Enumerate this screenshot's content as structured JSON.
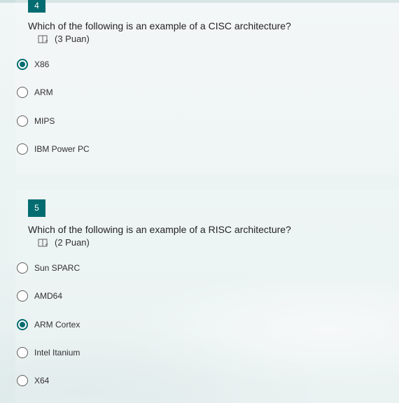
{
  "questions": [
    {
      "number": "4",
      "text": "Which of the following is an example of a CISC architecture?",
      "points": "(3 Puan)",
      "options": [
        {
          "label": "X86",
          "selected": true
        },
        {
          "label": "ARM",
          "selected": false
        },
        {
          "label": "MIPS",
          "selected": false
        },
        {
          "label": "IBM Power PC",
          "selected": false
        }
      ]
    },
    {
      "number": "5",
      "text": "Which of the following is an example of a RISC architecture?",
      "points": "(2 Puan)",
      "options": [
        {
          "label": "Sun SPARC",
          "selected": false
        },
        {
          "label": "AMD64",
          "selected": false
        },
        {
          "label": "ARM Cortex",
          "selected": true
        },
        {
          "label": "Intel Itanium",
          "selected": false
        },
        {
          "label": "X64",
          "selected": false
        }
      ]
    }
  ],
  "colors": {
    "accent": "#036c70",
    "background": "#eef4f4"
  },
  "icons": {
    "immersive_reader": "immersive-reader-icon"
  }
}
